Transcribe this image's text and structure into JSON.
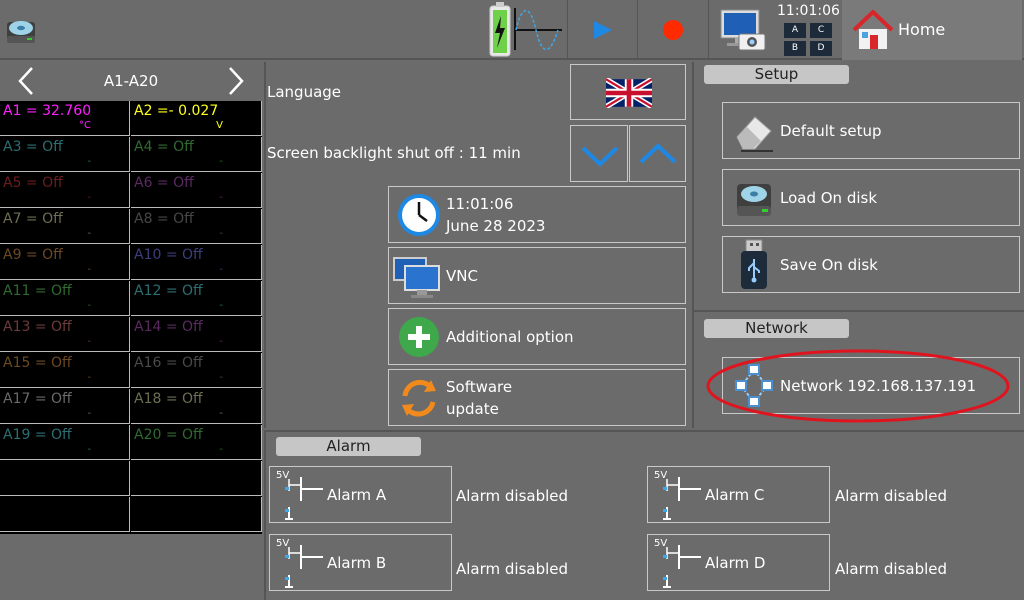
{
  "topbar": {
    "time": "11:01:06",
    "mini_grid": [
      "A",
      "C",
      "B",
      "D"
    ],
    "home_label": "Home"
  },
  "channels": {
    "range_label": "A1-A20",
    "items": [
      {
        "label": "A1 = 32.760",
        "unit": "°C",
        "color": "#ff20ff"
      },
      {
        "label": "A2 =- 0.027",
        "unit": "V",
        "color": "#ffff20"
      },
      {
        "label": "A3 = Off",
        "unit": "-",
        "color": "#2c6e72"
      },
      {
        "label": "A4 = Off",
        "unit": "-",
        "color": "#2f6a30"
      },
      {
        "label": "A5 = Off",
        "unit": "-",
        "color": "#6b1d1d"
      },
      {
        "label": "A6 = Off",
        "unit": "-",
        "color": "#5a2a60"
      },
      {
        "label": "A7 = Off",
        "unit": "-",
        "color": "#6e6e52"
      },
      {
        "label": "A8 = Off",
        "unit": "-",
        "color": "#474747"
      },
      {
        "label": "A9 = Off",
        "unit": "-",
        "color": "#6b4a22"
      },
      {
        "label": "A10 = Off",
        "unit": "-",
        "color": "#3c3e7a"
      },
      {
        "label": "A11 = Off",
        "unit": "-",
        "color": "#2f6a30"
      },
      {
        "label": "A12 = Off",
        "unit": "-",
        "color": "#2c6e72"
      },
      {
        "label": "A13 = Off",
        "unit": "-",
        "color": "#6b3a3a"
      },
      {
        "label": "A14 = Off",
        "unit": "-",
        "color": "#5a2a60"
      },
      {
        "label": "A15 = Off",
        "unit": "-",
        "color": "#6b4a22"
      },
      {
        "label": "A16 = Off",
        "unit": "-",
        "color": "#4a4a4a"
      },
      {
        "label": "A17 = Off",
        "unit": "-",
        "color": "#6a6a6a"
      },
      {
        "label": "A18 = Off",
        "unit": "-",
        "color": "#6e6e52"
      },
      {
        "label": "A19 = Off",
        "unit": "-",
        "color": "#2c6e72"
      },
      {
        "label": "A20 = Off",
        "unit": "-",
        "color": "#2f6a30"
      }
    ]
  },
  "settings": {
    "language_label": "Language",
    "backlight_label": "Screen backlight shut off : 11 min",
    "clock_time": "11:01:06",
    "clock_date": "June 28 2023",
    "vnc_label": "VNC",
    "additional_label": "Additional option",
    "software_line1": "Software",
    "software_line2": "update"
  },
  "setup": {
    "title": "Setup",
    "default_label": "Default setup",
    "load_label": "Load On disk",
    "save_label": "Save On disk"
  },
  "network": {
    "title": "Network",
    "button_label": "Network 192.168.137.191"
  },
  "alarm": {
    "title": "Alarm",
    "voltage": "5V",
    "items": [
      {
        "label": "Alarm  A",
        "status": "Alarm disabled"
      },
      {
        "label": "Alarm  B",
        "status": "Alarm disabled"
      },
      {
        "label": "Alarm  C",
        "status": "Alarm disabled"
      },
      {
        "label": "Alarm  D",
        "status": "Alarm disabled"
      }
    ]
  },
  "colors": {
    "background": "#6b6b6b",
    "accent_blue": "#1e88e5",
    "record_red": "#ff2a00",
    "highlight_ring": "#e0141e"
  }
}
